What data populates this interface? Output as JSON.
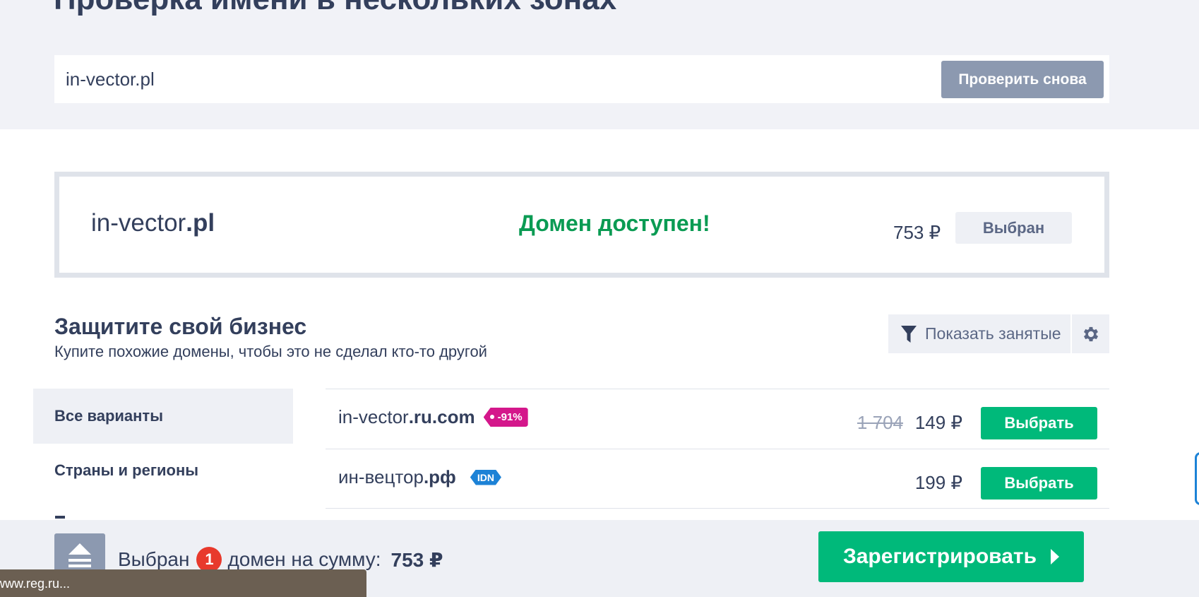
{
  "header": {
    "title": "Проверка имени в нескольких зонах",
    "search_value": "in-vector.pl",
    "recheck_label": "Проверить снова"
  },
  "result": {
    "domain_name": "in-vector",
    "domain_zone": ".pl",
    "status": "Домен доступен!",
    "price": "753 ₽",
    "chosen_label": "Выбран",
    "status_color": "#0a9b53"
  },
  "protect": {
    "title": "Защитите свой бизнес",
    "subtitle": "Купите похожие домены, чтобы это не сделал кто-то другой",
    "filter_label": "Показать занятые",
    "filter_icon": "filter-icon",
    "settings_icon": "gear-icon"
  },
  "categories": [
    {
      "label": "Все варианты",
      "active": true
    },
    {
      "label": "Страны и регионы",
      "active": false
    }
  ],
  "suggestions": [
    {
      "name": "in-vector",
      "zone": ".ru.com",
      "badge": "-91%",
      "old_price": "1 704",
      "price": "149 ₽",
      "button": "Выбрать"
    },
    {
      "name": "ин-вецтор",
      "zone": ".рф",
      "badge": "IDN",
      "old_price": "",
      "price": "199 ₽",
      "button": "Выбрать"
    }
  ],
  "cart": {
    "prefix": "Выбран",
    "count": "1",
    "middle": "домен на сумму:",
    "total": "753 ₽",
    "register_label": "Зарегистрировать"
  },
  "status_bar": {
    "url": "www.reg.ru..."
  },
  "colors": {
    "accent_green": "#00b97a",
    "discount_badge": "#d4178b",
    "idn_badge": "#1c82d6",
    "count_badge": "#e8392c"
  }
}
